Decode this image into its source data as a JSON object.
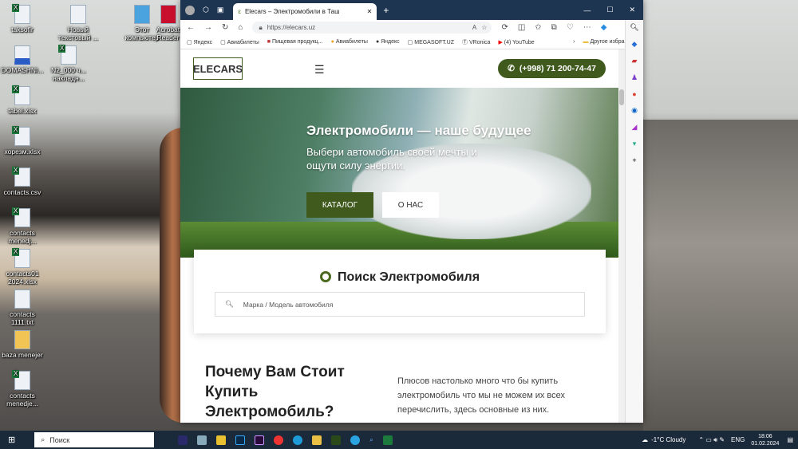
{
  "desktop": {
    "icons": [
      {
        "label": "taksofir"
      },
      {
        "label": "Новый текстовый ..."
      },
      {
        "label": "Этот компьютер"
      },
      {
        "label": "Acrobat Reader"
      },
      {
        "label": "DOMASHNI..."
      },
      {
        "label": "N2_000 ч... накладн..."
      },
      {
        "label": "tabel.xlsx"
      },
      {
        "label": "хорезм.xlsx"
      },
      {
        "label": "contacts.csv"
      },
      {
        "label": "contacts menedj..."
      },
      {
        "label": "contacts01 2024.xlsx"
      },
      {
        "label": "contacts 1111.txt"
      },
      {
        "label": "baza menejer"
      },
      {
        "label": "contacts menedje..."
      }
    ]
  },
  "browser": {
    "tab_title": "Elecars – Электромобили в Таш",
    "url": "https://elecars.uz",
    "bookmarks": [
      "Яндекс",
      "Авиабилеты",
      "Пищевая продукц...",
      "Авиабилеты",
      "Яндекс",
      "MEGASOFT.UZ",
      "VRonica",
      "(4) YouTube"
    ],
    "other_favorites": "Другое избранное"
  },
  "site": {
    "logo": "ELECARS",
    "phone": "(+998) 71 200-74-47",
    "hero_title": "Электромобили — наше будущее",
    "hero_text": "Выбери автомобиль своей мечты и ощути силу энергии.",
    "catalog_button": "КАТАЛОГ",
    "about_button": "О НАС",
    "search_title": "Поиск Электромобиля",
    "search_placeholder": "Марка / Модель автомобиля",
    "why_title": "Почему Вам Стоит Купить Электромобиль?",
    "why_text": "Плюсов настолько много что бы купить электромобиль что мы не можем их всех перечислить, здесь основные из них."
  },
  "taskbar": {
    "search": "Поиск",
    "weather": "-1°C  Cloudy",
    "lang": "ENG",
    "time": "18:06",
    "date": "01.02.2024"
  }
}
